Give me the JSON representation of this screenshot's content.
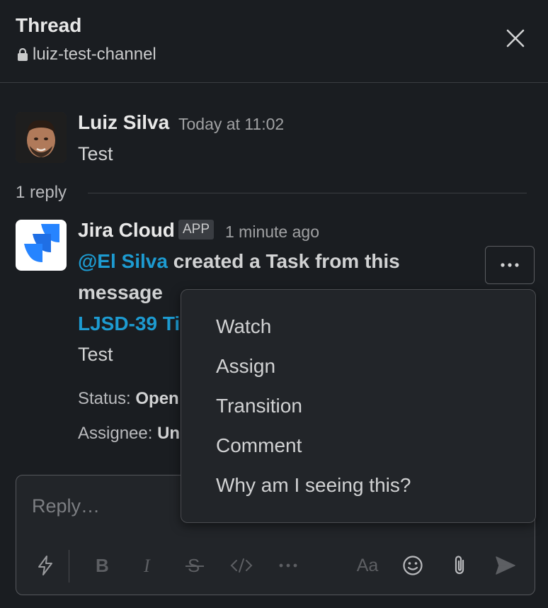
{
  "header": {
    "title": "Thread",
    "channel": "luiz-test-channel"
  },
  "parent_message": {
    "author": "Luiz Silva",
    "time": "Today at 11:02",
    "text": "Test"
  },
  "replies": {
    "count_label": "1 reply"
  },
  "reply_message": {
    "author": "Jira Cloud",
    "badge": "APP",
    "time": "1 minute ago",
    "mention": "@El Silva",
    "line1_rest": " created a Task from this",
    "line2": "message",
    "issue_link": "LJSD-39 Ti",
    "issue_text": "Test",
    "status_label": "Status: ",
    "status_value": "Open",
    "assignee_label": "Assignee: ",
    "assignee_value": "Un"
  },
  "context_menu": {
    "items": [
      "Watch",
      "Assign",
      "Transition",
      "Comment",
      "Why am I seeing this?"
    ]
  },
  "composer": {
    "placeholder": "Reply…",
    "format_button": "Aa"
  },
  "colors": {
    "background": "#1a1d21",
    "link": "#1d9bd1",
    "jira_blue": "#2684ff"
  },
  "icons": {
    "lock": "lock-icon",
    "close": "close-icon",
    "more": "more-horizontal-icon",
    "shortcuts": "lightning-icon",
    "bold": "bold-icon",
    "italic": "italic-icon",
    "strike": "strikethrough-icon",
    "code": "code-icon",
    "more_format": "more-formatting-icon",
    "emoji": "emoji-icon",
    "attach": "paperclip-icon",
    "send": "send-icon"
  }
}
